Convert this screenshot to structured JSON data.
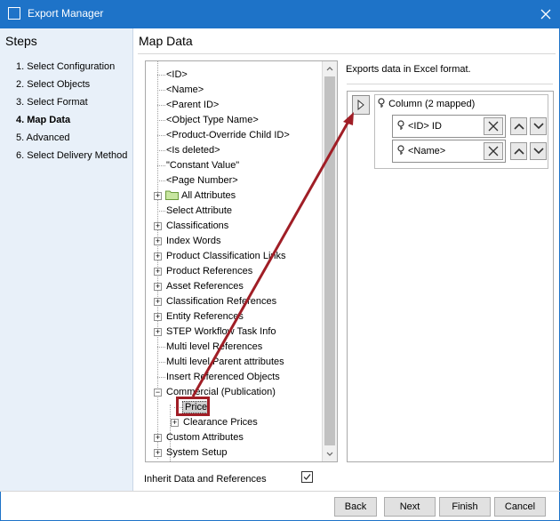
{
  "window": {
    "title": "Export Manager"
  },
  "steps": {
    "header": "Steps",
    "items": [
      "1. Select Configuration",
      "2. Select Objects",
      "3. Select Format",
      "4. Map Data",
      "5. Advanced",
      "6. Select Delivery Method"
    ],
    "active_index": 3
  },
  "main": {
    "title": "Map Data"
  },
  "tree": {
    "items": [
      {
        "label": "<ID>",
        "depth": 0,
        "expander": false
      },
      {
        "label": "<Name>",
        "depth": 0,
        "expander": false
      },
      {
        "label": "<Parent ID>",
        "depth": 0,
        "expander": false
      },
      {
        "label": "<Object Type Name>",
        "depth": 0,
        "expander": false
      },
      {
        "label": "<Product-Override Child ID>",
        "depth": 0,
        "expander": false
      },
      {
        "label": "<Is deleted>",
        "depth": 0,
        "expander": false
      },
      {
        "label": "\"Constant Value\"",
        "depth": 0,
        "expander": false
      },
      {
        "label": "<Page Number>",
        "depth": 0,
        "expander": false
      },
      {
        "label": "All Attributes",
        "depth": 0,
        "expander": "plus",
        "icon": "folder-icon"
      },
      {
        "label": "Select Attribute",
        "depth": 0,
        "expander": false
      },
      {
        "label": "Classifications",
        "depth": 0,
        "expander": "plus"
      },
      {
        "label": "Index Words",
        "depth": 0,
        "expander": "plus"
      },
      {
        "label": "Product Classification Links",
        "depth": 0,
        "expander": "plus"
      },
      {
        "label": "Product References",
        "depth": 0,
        "expander": "plus"
      },
      {
        "label": "Asset References",
        "depth": 0,
        "expander": "plus"
      },
      {
        "label": "Classification References",
        "depth": 0,
        "expander": "plus"
      },
      {
        "label": "Entity References",
        "depth": 0,
        "expander": "plus"
      },
      {
        "label": "STEP Workflow Task Info",
        "depth": 0,
        "expander": "plus"
      },
      {
        "label": "Multi level References",
        "depth": 0,
        "expander": false
      },
      {
        "label": "Multi level Parent attributes",
        "depth": 0,
        "expander": false
      },
      {
        "label": "Insert Referenced Objects",
        "depth": 0,
        "expander": false
      },
      {
        "label": "Commercial (Publication)",
        "depth": 0,
        "expander": "minus"
      },
      {
        "label": "Price",
        "depth": 1,
        "expander": false,
        "selected": true
      },
      {
        "label": "Clearance Prices",
        "depth": 1,
        "expander": "plus"
      },
      {
        "label": "Custom Attributes",
        "depth": 0,
        "expander": "plus"
      },
      {
        "label": "System Setup",
        "depth": 0,
        "expander": "plus"
      }
    ]
  },
  "mapping": {
    "description": "Exports data in Excel format.",
    "column_header": "Column (2 mapped)",
    "rows": [
      {
        "label": "<ID> ID"
      },
      {
        "label": "<Name>"
      }
    ]
  },
  "options": {
    "inherit_label": "Inherit Data and References",
    "inherit_checked": true
  },
  "buttons": {
    "back": "Back",
    "next": "Next",
    "finish": "Finish",
    "cancel": "Cancel"
  },
  "colors": {
    "titlebar": "#1e73c8",
    "steps_bg": "#e8f0f9",
    "annotation": "#a01e26"
  }
}
